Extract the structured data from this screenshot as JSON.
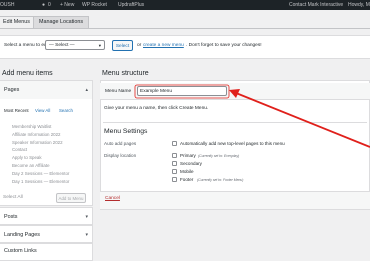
{
  "admin_bar": {
    "site_fragment": "OUSH",
    "comments_count": "0",
    "new_label": "+ New",
    "wp_rocket": "WP Rocket",
    "updraftplus": "UpdraftPlus",
    "contact": "Contact Mark Interactive",
    "howdy": "Howdy, M"
  },
  "tabs": {
    "edit_menus": "Edit Menus",
    "manage_locations": "Manage Locations"
  },
  "select_bar": {
    "prompt": "Select a menu to edit:",
    "selected_option": "— Select —",
    "select_button": "Select",
    "or": "or",
    "create_link": "create a new menu",
    "after_link": ". Don't forget to save your changes!"
  },
  "left": {
    "heading": "Add menu items",
    "pages": {
      "title": "Pages",
      "subtabs": [
        "Most Recent",
        "View All",
        "Search"
      ],
      "items": [
        "Membership Waitlist",
        "Affiliate Information 2022",
        "Speaker Information 2022",
        "Contact",
        "Apply to Speak",
        "Become an Affiliate",
        "Day 2 Sessions — Elementor",
        "Day 1 Sessions — Elementor"
      ],
      "select_all": "Select All",
      "add_button": "Add to Menu"
    },
    "posts": "Posts",
    "landing_pages": "Landing Pages",
    "custom_links": "Custom Links"
  },
  "right": {
    "heading": "Menu structure",
    "menu_name_label": "Menu Name",
    "menu_name_value": "Example Menu",
    "hint": "Give your menu a name, then click Create Menu.",
    "settings_heading": "Menu Settings",
    "auto_add_label": "Auto add pages",
    "auto_add_option": "Automatically add new top-level pages to this menu",
    "display_location_label": "Display location",
    "locations": [
      {
        "label": "Primary",
        "note": "(Currently set to: Everyday)"
      },
      {
        "label": "Secondary",
        "note": ""
      },
      {
        "label": "Mobile",
        "note": ""
      },
      {
        "label": "Footer",
        "note": "(Currently set to: Footer Menu)"
      }
    ],
    "cancel": "Cancel"
  },
  "colors": {
    "admin_bar": "#1d2327",
    "link": "#2271b1",
    "annotation_arrow": "#e0201b",
    "cancel": "#b32d2e"
  }
}
